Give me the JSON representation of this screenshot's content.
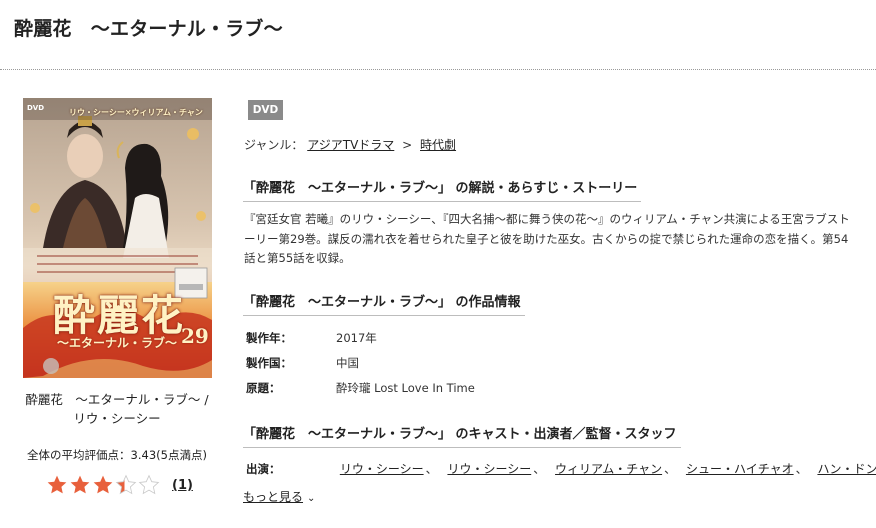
{
  "title": "酔麗花　〜エターナル・ラブ〜",
  "cover": {
    "badge_top_left": "DVD",
    "cast_names": "リウ・シーシー×ウィリアム・チャン",
    "logo_title": "酔麗花",
    "logo_subtitle": "〜エターナル・ラブ〜",
    "volume": "29"
  },
  "cover_caption": {
    "line1": "酔麗花　〜エターナル・ラブ〜 /",
    "line2": "リウ・シーシー"
  },
  "rating": {
    "text": "全体の平均評価点：3.43(5点満点)",
    "value": 3.43,
    "max": 5,
    "review_count": "(1)"
  },
  "badge": "DVD",
  "genre": {
    "label": "ジャンル：",
    "items": [
      "アジアTVドラマ",
      "時代劇"
    ],
    "separator": ">"
  },
  "synopsis_heading": "「酔麗花　〜エターナル・ラブ〜」 の解説・あらすじ・ストーリー",
  "synopsis": "『宮廷女官 若曦』のリウ・シーシー、『四大名捕〜都に舞う侠の花〜』のウィリアム・チャン共演による王宮ラブストーリー第29巻。謀反の濡れ衣を着せられた皇子と彼を助けた巫女。古くからの掟で禁じられた運命の恋を描く。第54話と第55話を収録。",
  "info_heading": "「酔麗花　〜エターナル・ラブ〜」 の作品情報",
  "info": [
    {
      "label": "製作年：",
      "value": "2017年"
    },
    {
      "label": "製作国：",
      "value": "中国"
    },
    {
      "label": "原題：",
      "value": "酔玲瓏 Lost Love In Time"
    }
  ],
  "cast_heading": "「酔麗花　〜エターナル・ラブ〜」 のキャスト・出演者／監督・スタッフ",
  "cast": {
    "label": "出演：",
    "names": [
      "リウ・シーシー",
      "リウ・シーシー",
      "ウィリアム・チャン",
      "シュー・ハイチャオ",
      "ハン・ドン"
    ],
    "separator": "、"
  },
  "more_link": "もっと見る",
  "colors": {
    "badge_bg": "#8a8a8a",
    "star": "#e8603c",
    "star_empty": "#cfcfcf",
    "cover_red": "#b8322a",
    "cover_gold": "#f2d27a"
  }
}
